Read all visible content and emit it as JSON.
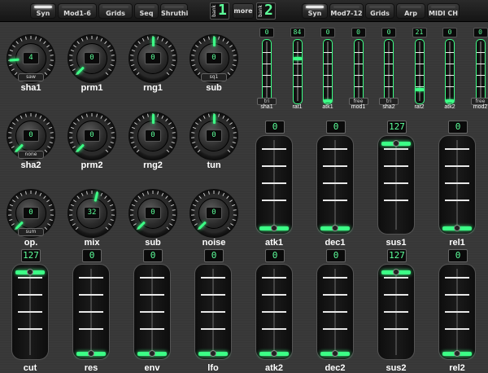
{
  "top_bar": {
    "left_tabs": [
      {
        "label": "Syn",
        "active": true
      },
      {
        "label": "Mod1-6",
        "active": false
      },
      {
        "label": "Grids",
        "active": false
      },
      {
        "label": "Seq",
        "active": false
      },
      {
        "label": "Shruthi",
        "active": false
      }
    ],
    "bank_left": {
      "label": "bank",
      "number": "1"
    },
    "more_label": "more",
    "bank_right": {
      "label": "bank",
      "number": "2"
    },
    "right_tabs": [
      {
        "label": "Syn",
        "active": true
      },
      {
        "label": "Mod7-12",
        "active": false
      },
      {
        "label": "Grids",
        "active": false
      },
      {
        "label": "Arp",
        "active": false
      },
      {
        "label": "MIDI CH",
        "active": false
      }
    ]
  },
  "knobs": [
    {
      "label": "sha1",
      "value": "4",
      "sub": "saw",
      "level": 0.15
    },
    {
      "label": "prm1",
      "value": "0",
      "sub": "",
      "level": 0.0
    },
    {
      "label": "rng1",
      "value": "0",
      "sub": "",
      "level": 0.5
    },
    {
      "label": "sub",
      "value": "0",
      "sub": "sq1",
      "level": 0.5
    },
    {
      "label": "sha2",
      "value": "0",
      "sub": "none",
      "level": 0.0
    },
    {
      "label": "prm2",
      "value": "0",
      "sub": "",
      "level": 0.0
    },
    {
      "label": "rng2",
      "value": "0",
      "sub": "",
      "level": 0.5
    },
    {
      "label": "tun",
      "value": "0",
      "sub": "",
      "level": 0.5
    },
    {
      "label": "op.",
      "value": "0",
      "sub": "sum",
      "level": 0.0
    },
    {
      "label": "mix",
      "value": "32",
      "sub": "",
      "level": 0.55
    },
    {
      "label": "sub",
      "value": "0",
      "sub": "",
      "level": 0.0
    },
    {
      "label": "noise",
      "value": "0",
      "sub": "",
      "level": 0.0
    }
  ],
  "small_faders": [
    {
      "label": "sha1",
      "value": "0",
      "tag": "tri",
      "level": 0.0
    },
    {
      "label": "rat1",
      "value": "84",
      "tag": "",
      "level": 0.75
    },
    {
      "label": "atk1",
      "value": "0",
      "tag": "",
      "level": 0.0
    },
    {
      "label": "mod1",
      "value": "0",
      "tag": "free",
      "level": 0.0
    },
    {
      "label": "sha2",
      "value": "0",
      "tag": "tri",
      "level": 0.0
    },
    {
      "label": "rat2",
      "value": "21",
      "tag": "",
      "level": 0.2
    },
    {
      "label": "atk2",
      "value": "0",
      "tag": "",
      "level": 0.0
    },
    {
      "label": "mod2",
      "value": "0",
      "tag": "free",
      "level": 0.0
    }
  ],
  "env_faders": [
    {
      "label": "atk1",
      "value": "0",
      "level": 0.0
    },
    {
      "label": "dec1",
      "value": "0",
      "level": 0.0
    },
    {
      "label": "sus1",
      "value": "127",
      "level": 1.0
    },
    {
      "label": "rel1",
      "value": "0",
      "level": 0.0
    }
  ],
  "bottom_faders": [
    {
      "label": "cut",
      "value": "127",
      "level": 1.0
    },
    {
      "label": "res",
      "value": "0",
      "level": 0.0
    },
    {
      "label": "env",
      "value": "0",
      "level": 0.0
    },
    {
      "label": "lfo",
      "value": "0",
      "level": 0.0
    },
    {
      "label": "atk2",
      "value": "0",
      "level": 0.0
    },
    {
      "label": "dec2",
      "value": "0",
      "level": 0.0
    },
    {
      "label": "sus2",
      "value": "127",
      "level": 1.0
    },
    {
      "label": "rel2",
      "value": "0",
      "level": 0.0
    }
  ],
  "accent_color": "#3cff86"
}
